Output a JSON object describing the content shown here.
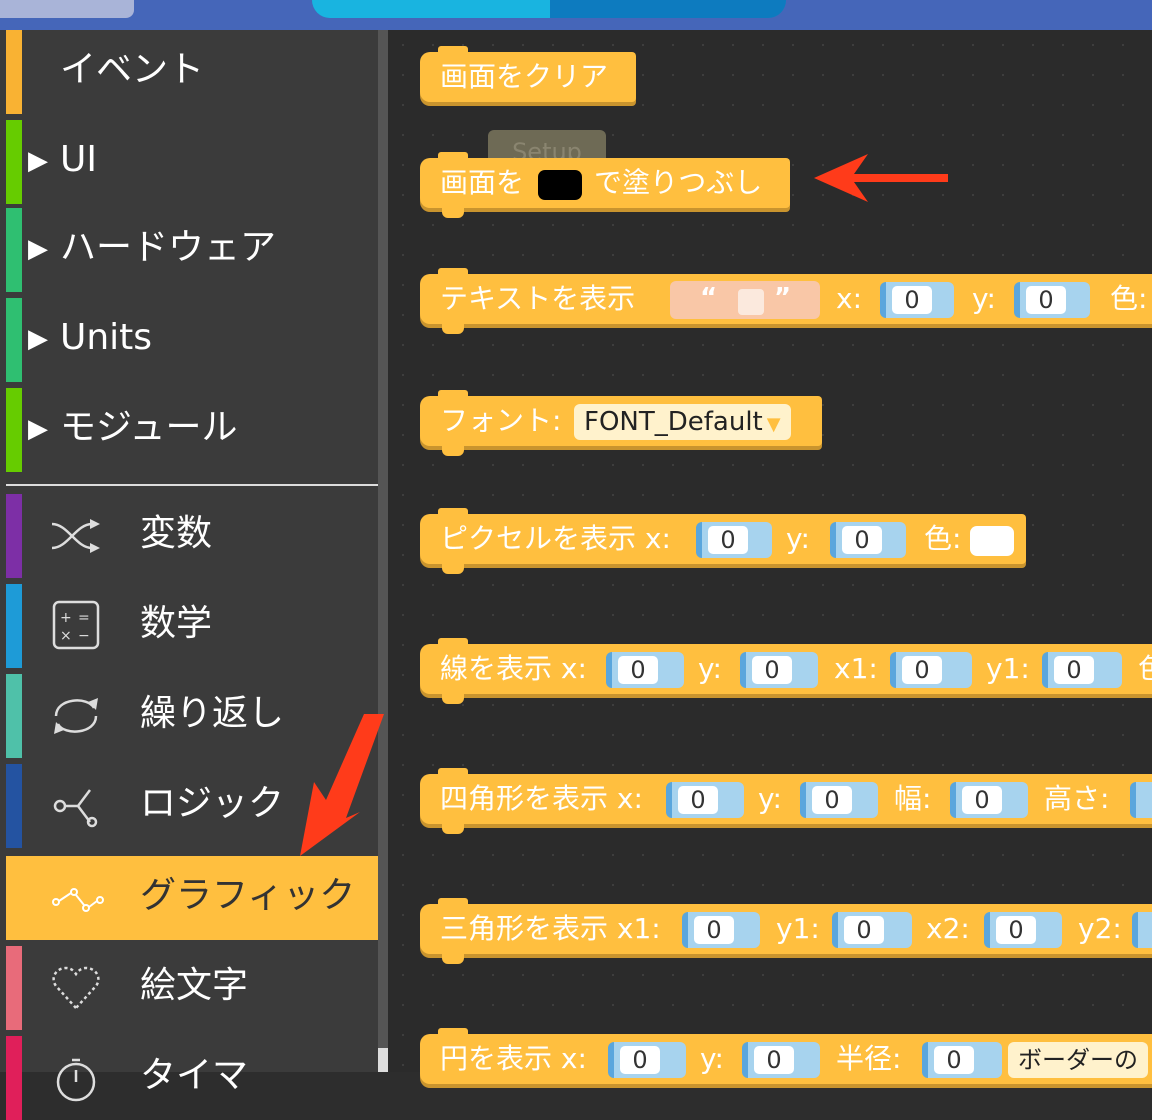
{
  "sidebar": {
    "categories": [
      {
        "label": "イベント",
        "color": "#f9b233",
        "has_arrow": false
      },
      {
        "label": "UI",
        "color": "#66cc00",
        "has_arrow": true
      },
      {
        "label": "ハードウェア",
        "color": "#2fbf71",
        "has_arrow": true
      },
      {
        "label": "Units",
        "color": "#2fbf71",
        "has_arrow": true
      },
      {
        "label": "モジュール",
        "color": "#66cc00",
        "has_arrow": true
      },
      {
        "label": "変数",
        "color": "#7d2fa6",
        "icon": "shuffle-icon"
      },
      {
        "label": "数学",
        "color": "#1e9bd7",
        "icon": "calculator-icon"
      },
      {
        "label": "繰り返し",
        "color": "#4fc1a9",
        "icon": "loop-icon"
      },
      {
        "label": "ロジック",
        "color": "#2453a1",
        "icon": "logic-branch-icon"
      },
      {
        "label": "グラフィック",
        "color": "#ffbf3f",
        "icon": "graph-nodes-icon",
        "selected": true
      },
      {
        "label": "絵文字",
        "color": "#e86b7a",
        "icon": "heart-grid-icon"
      },
      {
        "label": "タイマ",
        "color": "#e01f5a",
        "icon": "timer-icon"
      }
    ]
  },
  "workspace": {
    "ghost_label": "Setup",
    "blocks": {
      "clear": {
        "label": "画面をクリア"
      },
      "fill": {
        "label_before": "画面を",
        "label_after": "で塗りつぶし",
        "color": "#000000"
      },
      "text": {
        "label": "テキストを表示",
        "x_label": "x:",
        "x": "0",
        "y_label": "y:",
        "y": "0",
        "color_label": "色:",
        "open_quote": "“",
        "close_quote": "”"
      },
      "font": {
        "label": "フォント:",
        "value": "FONT_Default"
      },
      "pixel": {
        "label": "ピクセルを表示 x:",
        "x": "0",
        "y_label": "y:",
        "y": "0",
        "color_label": "色:",
        "color": "#ffffff"
      },
      "line": {
        "label": "線を表示 x:",
        "x": "0",
        "y_label": "y:",
        "y": "0",
        "x1_label": "x1:",
        "x1": "0",
        "y1_label": "y1:",
        "y1": "0",
        "color_label": "色"
      },
      "rect": {
        "label": "四角形を表示 x:",
        "x": "0",
        "y_label": "y:",
        "y": "0",
        "w_label": "幅:",
        "w": "0",
        "h_label": "高さ:"
      },
      "triangle": {
        "label": "三角形を表示 x1:",
        "x1": "0",
        "y1_label": "y1:",
        "y1": "0",
        "x2_label": "x2:",
        "x2": "0",
        "y2_label": "y2:"
      },
      "circle": {
        "label": "円を表示 x:",
        "x": "0",
        "y_label": "y:",
        "y": "0",
        "r_label": "半径:",
        "r": "0",
        "border_label": "ボーダーの"
      }
    }
  },
  "colors": {
    "accent": "#ffbf3f",
    "annotation": "#ff3b1a",
    "topbar": "#4566b9"
  }
}
